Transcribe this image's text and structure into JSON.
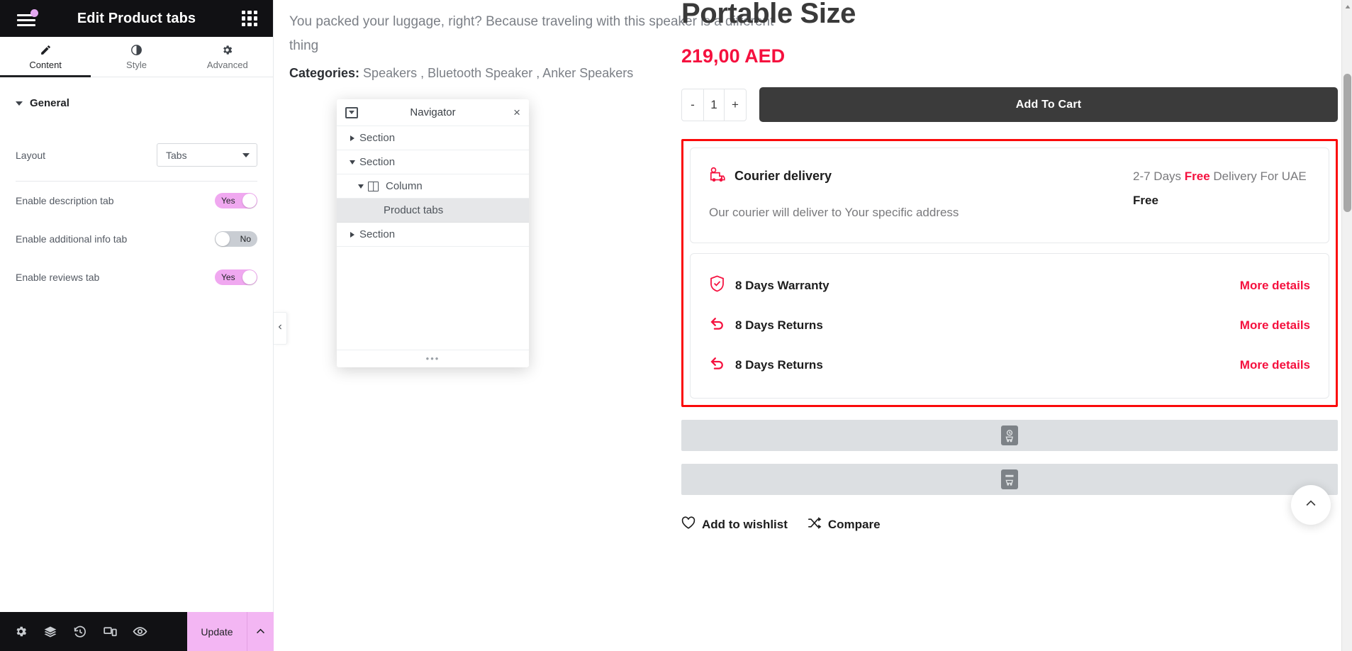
{
  "panel": {
    "title": "Edit Product tabs",
    "menu_icon": "hamburger-menu-icon",
    "apps_icon": "apps-grid-icon",
    "tabs": [
      {
        "label": "Content",
        "icon": "pencil-icon",
        "active": true
      },
      {
        "label": "Style",
        "icon": "contrast-icon",
        "active": false
      },
      {
        "label": "Advanced",
        "icon": "gear-icon",
        "active": false
      }
    ],
    "section": {
      "label": "General"
    },
    "controls": {
      "layout": {
        "label": "Layout",
        "value": "Tabs"
      },
      "description_tab": {
        "label": "Enable description tab",
        "value": "Yes"
      },
      "additional_info_tab": {
        "label": "Enable additional info tab",
        "value": "No"
      },
      "reviews_tab": {
        "label": "Enable reviews tab",
        "value": "Yes"
      }
    },
    "footer": {
      "icons": [
        "settings-gear-icon",
        "layers-icon",
        "history-revisions-icon",
        "responsive-mode-icon",
        "preview-eye-icon"
      ],
      "update_label": "Update",
      "update_caret": "chevron-up-icon"
    },
    "collapse_icon": "chevron-left-icon"
  },
  "navigator": {
    "title": "Navigator",
    "toggle_icon": "expand-all-icon",
    "close_icon": "close-x-icon",
    "close_label": "×",
    "resize_dots": "•••",
    "items": [
      {
        "label": "Section",
        "indent": 0,
        "state": "collapsed",
        "selected": false,
        "has_icon": false
      },
      {
        "label": "Section",
        "indent": 0,
        "state": "expanded",
        "selected": false,
        "has_icon": false
      },
      {
        "label": "Column",
        "indent": 1,
        "state": "expanded",
        "selected": false,
        "has_icon": true
      },
      {
        "label": "Product tabs",
        "indent": 2,
        "state": "leaf",
        "selected": true,
        "has_icon": false
      },
      {
        "label": "Section",
        "indent": 0,
        "state": "collapsed",
        "selected": false,
        "has_icon": false
      }
    ]
  },
  "canvas": {
    "description": "You packed your luggage, right? Because traveling with this speaker is a different thing",
    "categories_label": "Categories:",
    "categories": "Speakers , Bluetooth Speaker , Anker Speakers"
  },
  "product": {
    "title": "Portable Size",
    "price": "219,00 AED",
    "qty": {
      "minus": "-",
      "value": "1",
      "plus": "+"
    },
    "add_to_cart": "Add To Cart",
    "courier": {
      "icon": "delivery-truck-icon",
      "heading": "Courier delivery",
      "description": "Our courier will deliver to Your specific address",
      "shipping_prefix": "2-7 Days ",
      "shipping_highlight": "Free",
      "shipping_suffix": " Delivery For UAE",
      "cost": "Free"
    },
    "guarantees": [
      {
        "icon": "shield-check-icon",
        "label": "8 Days Warranty",
        "link": "More details"
      },
      {
        "icon": "return-arrow-icon",
        "label": "8 Days Returns",
        "link": "More details"
      },
      {
        "icon": "return-arrow-icon",
        "label": "8 Days Returns",
        "link": "More details"
      }
    ],
    "placeholders": [
      {
        "icon": "recently-viewed-cart-icon"
      },
      {
        "icon": "sticky-cart-icon"
      }
    ],
    "wishlist": {
      "icon": "heart-icon",
      "label": "Add to wishlist"
    },
    "compare": {
      "icon": "compare-icon",
      "label": "Compare"
    },
    "scroll_top_icon": "chevron-up-icon"
  },
  "colors": {
    "accent_pink": "#f0a8f0",
    "price_red": "#f5103e",
    "highlight_red": "#fb0a0a",
    "panel_dark": "#111114",
    "cart_dark": "#3b3b3b"
  }
}
